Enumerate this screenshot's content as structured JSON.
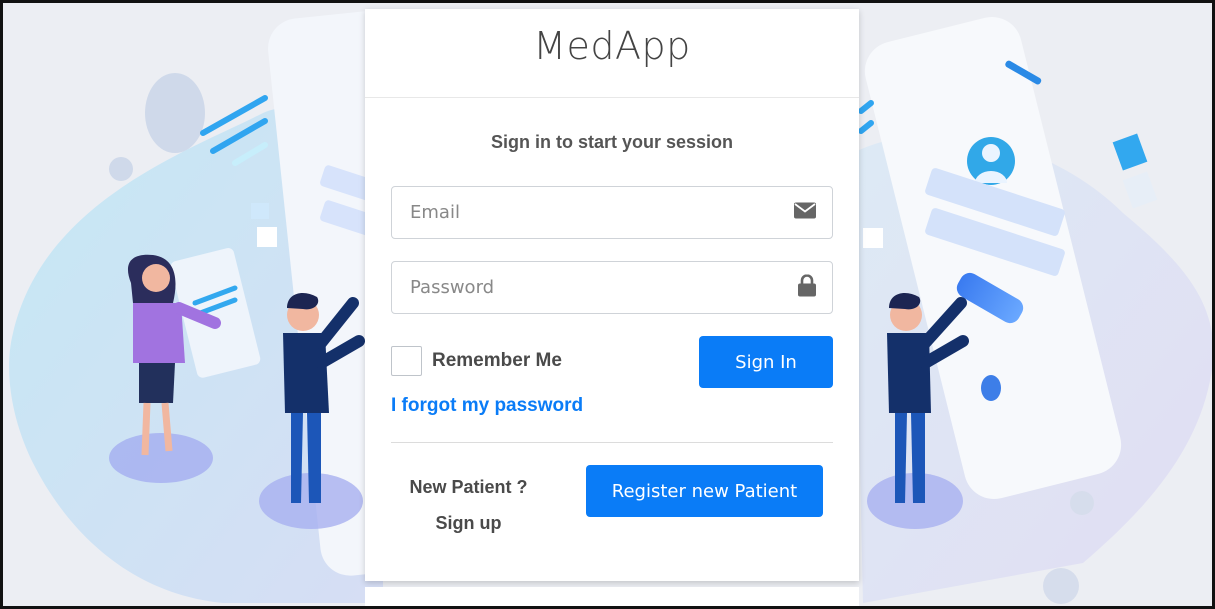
{
  "app": {
    "brand": "MedApp"
  },
  "login": {
    "subtitle": "Sign in to start your session",
    "email_placeholder": "Email",
    "password_placeholder": "Password",
    "remember_label": "Remember Me",
    "signin_label": "Sign In",
    "forgot_label": "I forgot my password",
    "new_patient_line1": "New Patient ?",
    "new_patient_line2": "Sign up",
    "register_label": "Register new Patient"
  },
  "icons": {
    "email": "envelope-icon",
    "password": "lock-icon"
  },
  "colors": {
    "accent": "#0a7cf7",
    "text": "#4a4a4a",
    "background": "#eceef3"
  }
}
